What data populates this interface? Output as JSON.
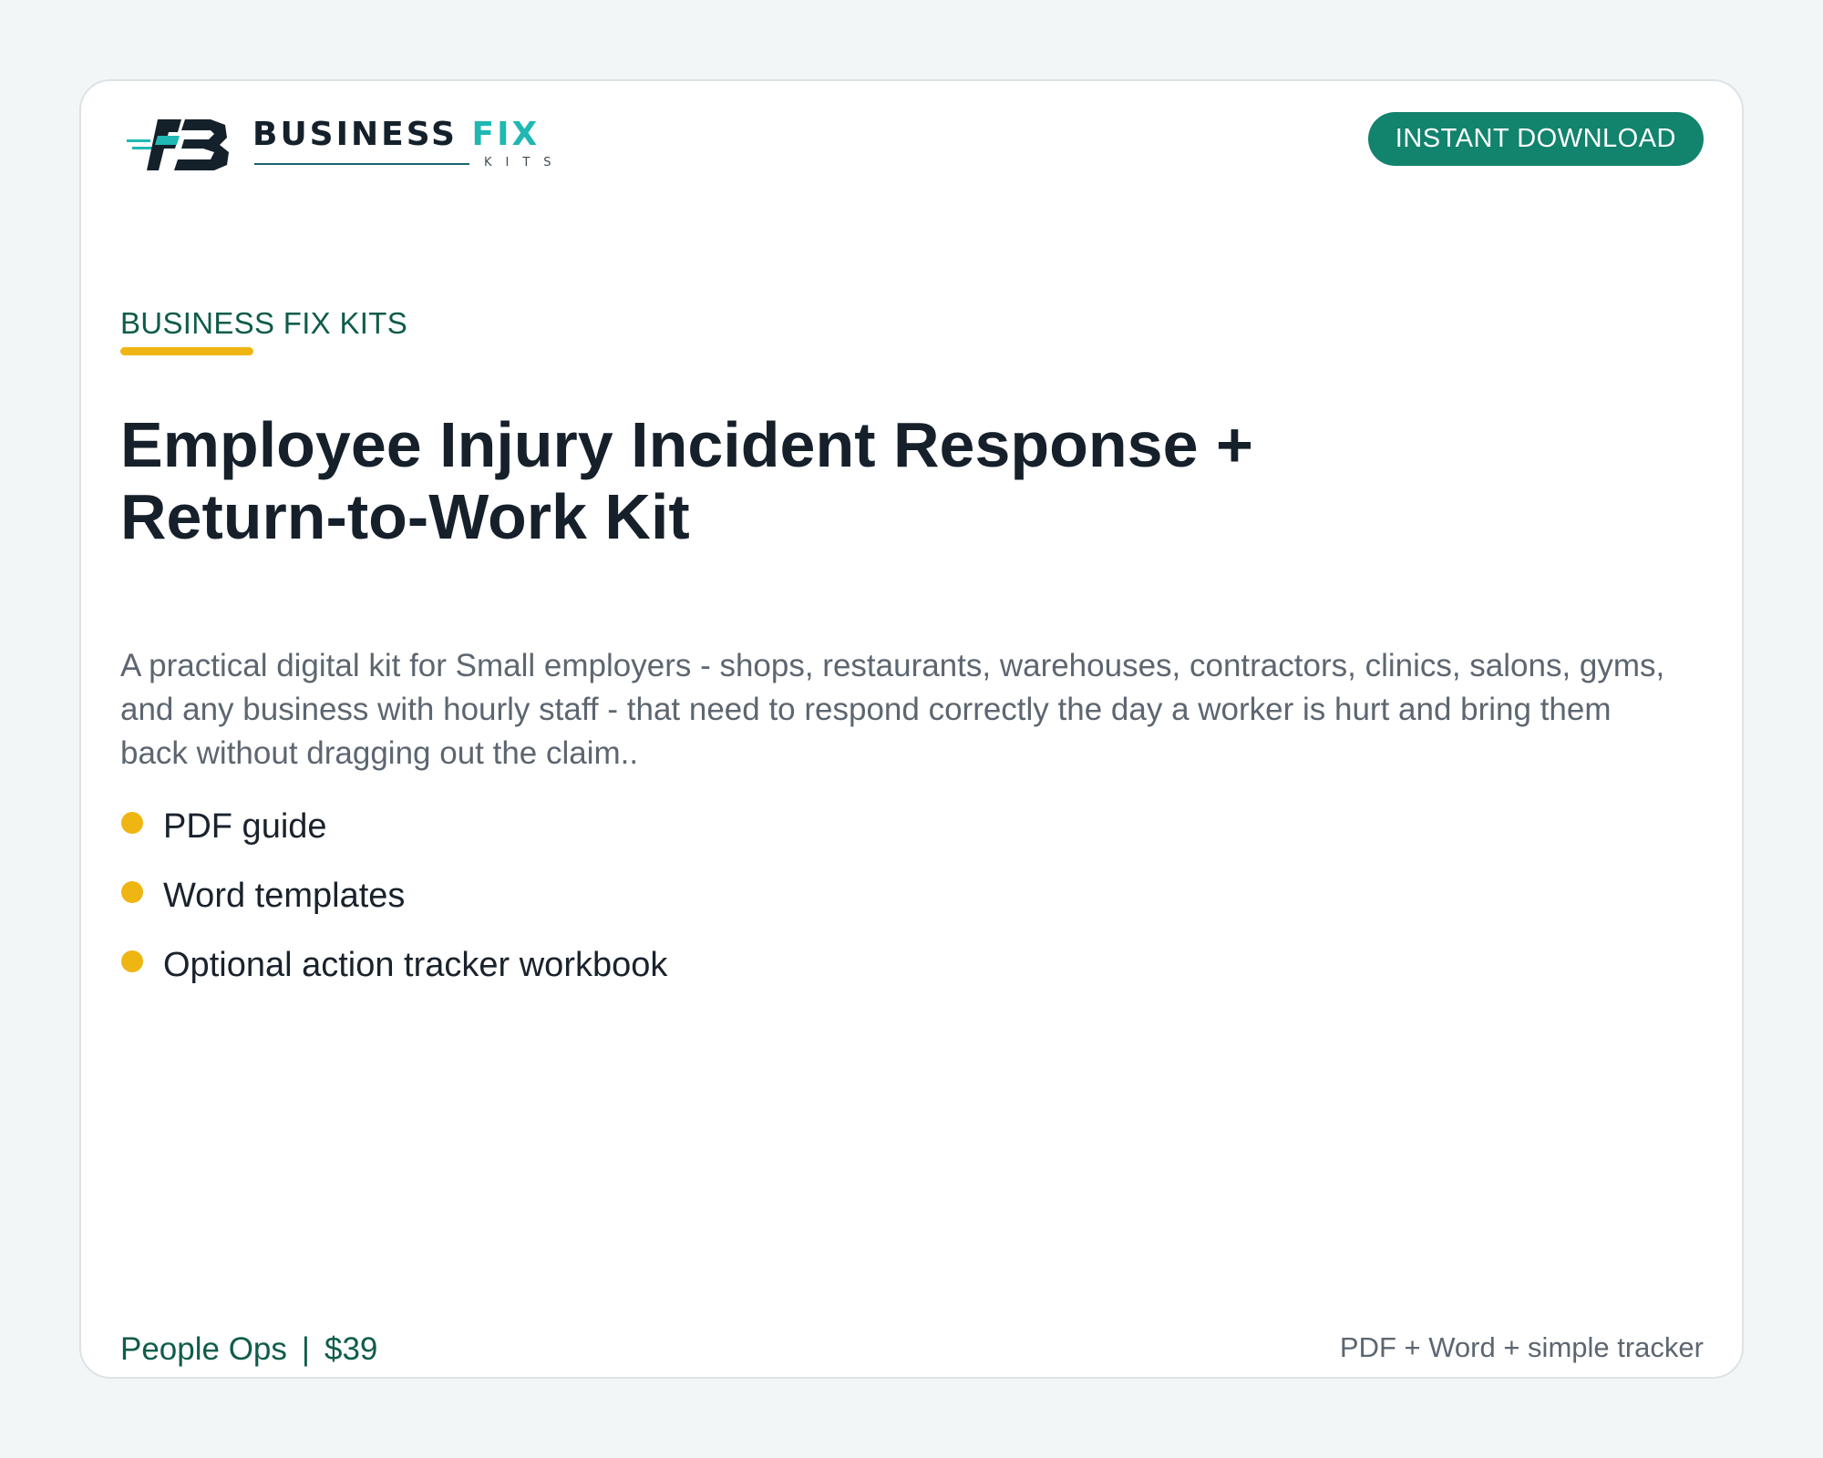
{
  "brand": {
    "name_primary": "BUSINESS",
    "name_accent": "FIX",
    "name_sub": "KITS",
    "colors": {
      "navy": "#14212b",
      "teal": "#1fb8b4",
      "green": "#12836c",
      "dark_green": "#0f5c4b",
      "yellow": "#efb512"
    }
  },
  "badge": {
    "label": "INSTANT DOWNLOAD"
  },
  "eyebrow": "BUSINESS FIX KITS",
  "title": "Employee Injury Incident Response + Return-to-Work Kit",
  "description": "A practical digital kit for Small employers - shops, restaurants, warehouses, contractors, clinics, salons, gyms, and any business with hourly staff - that need to respond correctly the day a worker is hurt and bring them back without dragging out the claim..",
  "features": [
    "PDF guide",
    "Word templates",
    "Optional action tracker workbook"
  ],
  "footer": {
    "category": "People Ops",
    "separator": "|",
    "price": "$39",
    "formats": "PDF + Word + simple tracker"
  }
}
